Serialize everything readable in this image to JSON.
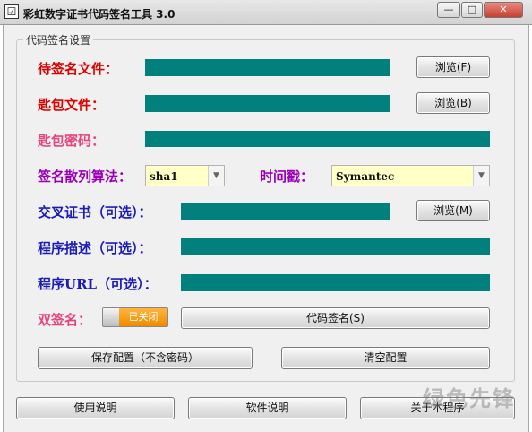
{
  "window": {
    "title": "彩虹数字证书代码签名工具 3.0"
  },
  "titlebar": {
    "minimize": "—",
    "maximize": "□",
    "close": "✕"
  },
  "group": {
    "label": "代码签名设置"
  },
  "fields": {
    "pending_file": {
      "label": "待签名文件：",
      "browse": "浏览(F)"
    },
    "key_file": {
      "label": "匙包文件：",
      "browse": "浏览(B)"
    },
    "key_password": {
      "label": "匙包密码："
    },
    "hash_alg": {
      "label": "签名散列算法：",
      "value": "sha1"
    },
    "timestamp": {
      "label": "时间戳：",
      "value": "Symantec"
    },
    "cross_cert": {
      "label": "交叉证书（可选）：",
      "browse": "浏览(M)"
    },
    "description": {
      "label": "程序描述（可选）："
    },
    "url": {
      "label": "程序URL（可选）："
    },
    "dual_sign": {
      "label": "双签名：",
      "state": "已关闭"
    }
  },
  "buttons": {
    "code_sign": "代码签名(S)",
    "save_config": "保存配置（不含密码）",
    "clear_config": "清空配置",
    "usage": "使用说明",
    "software": "软件说明",
    "about": "关于本程序"
  },
  "watermark": "绿色先锋",
  "colors": {
    "field": "#02807e",
    "combo_bg": "#ffffc8",
    "toggle": "#f39200"
  }
}
